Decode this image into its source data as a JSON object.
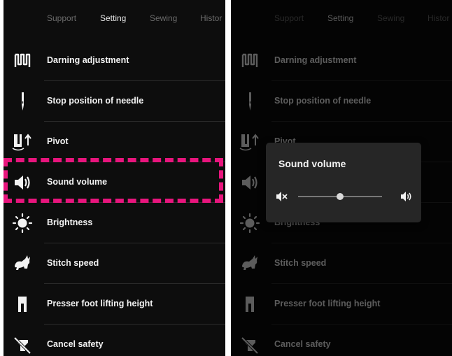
{
  "tabs": [
    {
      "label": "Support",
      "active": false
    },
    {
      "label": "Setting",
      "active": true
    },
    {
      "label": "Sewing",
      "active": false
    },
    {
      "label": "Histor",
      "active": false
    }
  ],
  "settings": [
    {
      "label": "Darning adjustment",
      "icon": "darning-icon"
    },
    {
      "label": "Stop position of needle",
      "icon": "needle-icon"
    },
    {
      "label": "Pivot",
      "icon": "pivot-icon"
    },
    {
      "label": "Sound volume",
      "icon": "speaker-icon"
    },
    {
      "label": "Brightness",
      "icon": "sun-icon"
    },
    {
      "label": "Stitch speed",
      "icon": "rabbit-icon"
    },
    {
      "label": "Presser foot lifting height",
      "icon": "presser-foot-icon"
    },
    {
      "label": "Cancel safety",
      "icon": "cancel-safety-icon"
    }
  ],
  "highlighted_item": "Sound volume",
  "colors": {
    "highlight": "#e8157d",
    "background": "#0d0d0d",
    "dialog": "#262626"
  },
  "sound_dialog": {
    "title": "Sound volume",
    "min_icon": "mute-icon",
    "max_icon": "volume-up-icon",
    "level": 0.5
  }
}
